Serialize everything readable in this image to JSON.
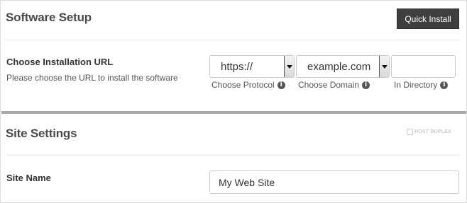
{
  "software_setup": {
    "title": "Software Setup",
    "quick_install_label": "Quick Install"
  },
  "installation_url": {
    "label": "Choose Installation URL",
    "help": "Please choose the URL to install the software",
    "protocol": {
      "value": "https://",
      "sublabel": "Choose Protocol"
    },
    "domain": {
      "value": "example.com",
      "sublabel": "Choose Domain"
    },
    "directory": {
      "value": "",
      "sublabel": "In Directory"
    }
  },
  "site_settings": {
    "title": "Site Settings",
    "logo_text": "HOST DUPLEX",
    "site_name_label": "Site Name",
    "site_name_value": "My Web Site"
  },
  "icons": {
    "info": "info-icon",
    "dropdown": "chevron-down-icon"
  },
  "colors": {
    "button_bg": "#3f3f3f",
    "separator": "#a9a9a9"
  }
}
